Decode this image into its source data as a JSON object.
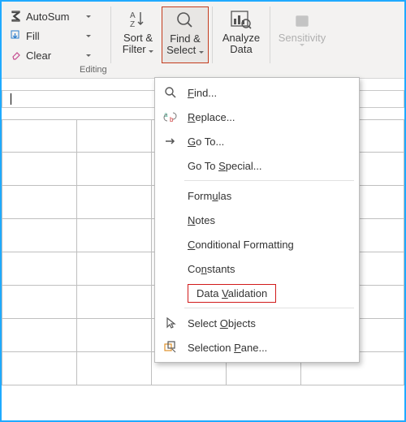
{
  "ribbon": {
    "editing": {
      "autosum": "AutoSum",
      "fill": "Fill",
      "clear": "Clear"
    },
    "sort_filter_l1": "Sort &",
    "sort_filter_l2": "Filter",
    "find_select_l1": "Find &",
    "find_select_l2": "Select",
    "analyze_l1": "Analyze",
    "analyze_l2": "Data",
    "sensitivity": "Sensitivity",
    "group_label": "Editing"
  },
  "menu": {
    "find": "Find...",
    "replace": "Replace...",
    "goto": "Go To...",
    "goto_special": "Go To Special...",
    "formulas": "Formulas",
    "notes": "Notes",
    "cond_fmt": "Conditional Formatting",
    "constants": "Constants",
    "data_validation": "Data Validation",
    "select_objects": "Select Objects",
    "selection_pane": "Selection Pane...",
    "letters": {
      "find": "F",
      "replace": "R",
      "goto": "G",
      "special": "S",
      "formulas": "u",
      "notes": "N",
      "cond": "C",
      "constants": "n",
      "validation": "V",
      "objects": "O",
      "pane": "P"
    }
  }
}
